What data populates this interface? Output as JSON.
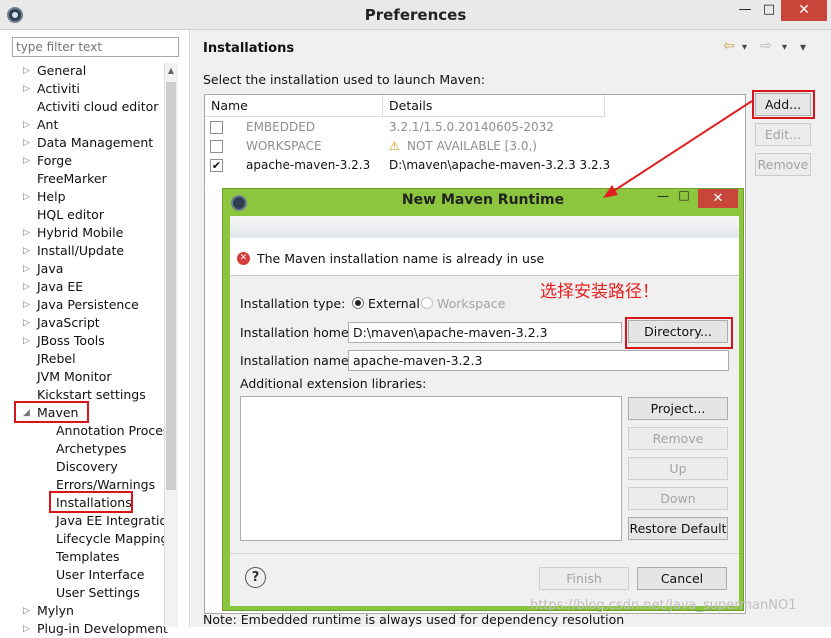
{
  "window": {
    "title": "Preferences",
    "minimize_glyph": "—",
    "maximize_glyph": "□",
    "close_glyph": "✕"
  },
  "sidebar": {
    "filter_placeholder": "type filter text",
    "items": [
      {
        "label": "General",
        "expander": "▷"
      },
      {
        "label": "Activiti",
        "expander": "▷"
      },
      {
        "label": "Activiti cloud editor",
        "expander": ""
      },
      {
        "label": "Ant",
        "expander": "▷"
      },
      {
        "label": "Data Management",
        "expander": "▷"
      },
      {
        "label": "Forge",
        "expander": "▷"
      },
      {
        "label": "FreeMarker",
        "expander": ""
      },
      {
        "label": "Help",
        "expander": "▷"
      },
      {
        "label": "HQL editor",
        "expander": ""
      },
      {
        "label": "Hybrid Mobile",
        "expander": "▷"
      },
      {
        "label": "Install/Update",
        "expander": "▷"
      },
      {
        "label": "Java",
        "expander": "▷"
      },
      {
        "label": "Java EE",
        "expander": "▷"
      },
      {
        "label": "Java Persistence",
        "expander": "▷"
      },
      {
        "label": "JavaScript",
        "expander": "▷"
      },
      {
        "label": "JBoss Tools",
        "expander": "▷"
      },
      {
        "label": "JRebel",
        "expander": ""
      },
      {
        "label": "JVM Monitor",
        "expander": ""
      },
      {
        "label": "Kickstart settings",
        "expander": ""
      },
      {
        "label": "Maven",
        "expander": "◢"
      },
      {
        "label": "Annotation Proces",
        "expander": ""
      },
      {
        "label": "Archetypes",
        "expander": ""
      },
      {
        "label": "Discovery",
        "expander": ""
      },
      {
        "label": "Errors/Warnings",
        "expander": ""
      },
      {
        "label": "Installations",
        "expander": ""
      },
      {
        "label": "Java EE Integratior",
        "expander": ""
      },
      {
        "label": "Lifecycle Mapping",
        "expander": ""
      },
      {
        "label": "Templates",
        "expander": ""
      },
      {
        "label": "User Interface",
        "expander": ""
      },
      {
        "label": "User Settings",
        "expander": ""
      },
      {
        "label": "Mylyn",
        "expander": "▷"
      },
      {
        "label": "Plug-in Development",
        "expander": "▷"
      }
    ]
  },
  "main": {
    "title": "Installations",
    "nav_back": "⇦",
    "nav_forward": "⇨",
    "nav_menu": "▾",
    "description": "Select the installation used to launch Maven:",
    "columns": [
      "Name",
      "Details"
    ],
    "rows": [
      {
        "name": "EMBEDDED",
        "details": "3.2.1/1.5.0.20140605-2032",
        "checked": "",
        "warning": ""
      },
      {
        "name": "WORKSPACE",
        "details": "NOT AVAILABLE [3.0,)",
        "checked": "",
        "warning": "⚠"
      },
      {
        "name": "apache-maven-3.2.3",
        "details": "D:\\maven\\apache-maven-3.2.3 3.2.3",
        "checked": "✔",
        "warning": ""
      }
    ],
    "buttons": {
      "add": "Add...",
      "edit": "Edit...",
      "remove": "Remove"
    },
    "note": "Note: Embedded runtime is always used for dependency resolution"
  },
  "dialog": {
    "title": "New Maven Runtime",
    "minimize_glyph": "—",
    "maximize_glyph": "□",
    "close_glyph": "✕",
    "error_icon": "✕",
    "error_message": "The Maven installation name is already in use",
    "annotation": "选择安装路径！",
    "installation_type_label": "Installation type:",
    "type_external": "External",
    "type_workspace": "Workspace",
    "installation_home_label": "Installation home:",
    "installation_home_value": "D:\\maven\\apache-maven-3.2.3",
    "directory_button": "Directory...",
    "installation_name_label": "Installation name:",
    "installation_name_value": "apache-maven-3.2.3",
    "ext_libs_label": "Additional extension libraries:",
    "buttons": {
      "project": "Project...",
      "remove": "Remove",
      "up": "Up",
      "down": "Down",
      "restore": "Restore Default",
      "finish": "Finish",
      "cancel": "Cancel"
    },
    "help_glyph": "?"
  },
  "watermark": "https://blog.csdn.net/Java_supermanNO1",
  "colors": {
    "highlight_red": "#d9151c",
    "dialog_frame": "#8cc63e",
    "annotation_red": "#e8201e"
  }
}
